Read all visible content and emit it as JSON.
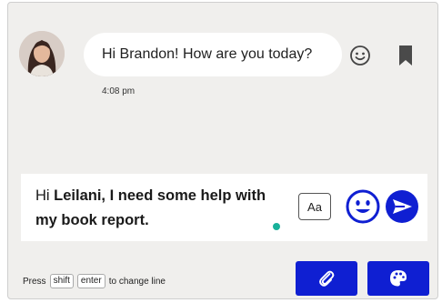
{
  "colors": {
    "panel_background": "#f0efed",
    "accent_blue": "#0f1fd2",
    "typing_indicator": "#19b19a"
  },
  "message": {
    "text": "Hi Brandon! How are you today?",
    "timestamp": "4:08 pm",
    "avatar_icon": "user-avatar-photo",
    "react_icon": "smiley-face-icon",
    "bookmark_icon": "bookmark-icon"
  },
  "composer": {
    "text_plain": "Hi ",
    "text_bold": "Leilani, I need some help with my book report.",
    "format_button_label": "Aa",
    "emoji_icon": "smiley-face-icon",
    "send_icon": "send-arrow-icon"
  },
  "footer": {
    "hint_prefix": "Press",
    "key_shift": "shift",
    "key_enter": "enter",
    "hint_suffix": "to change line",
    "attach_icon": "paperclip-icon",
    "theme_icon": "palette-icon"
  }
}
